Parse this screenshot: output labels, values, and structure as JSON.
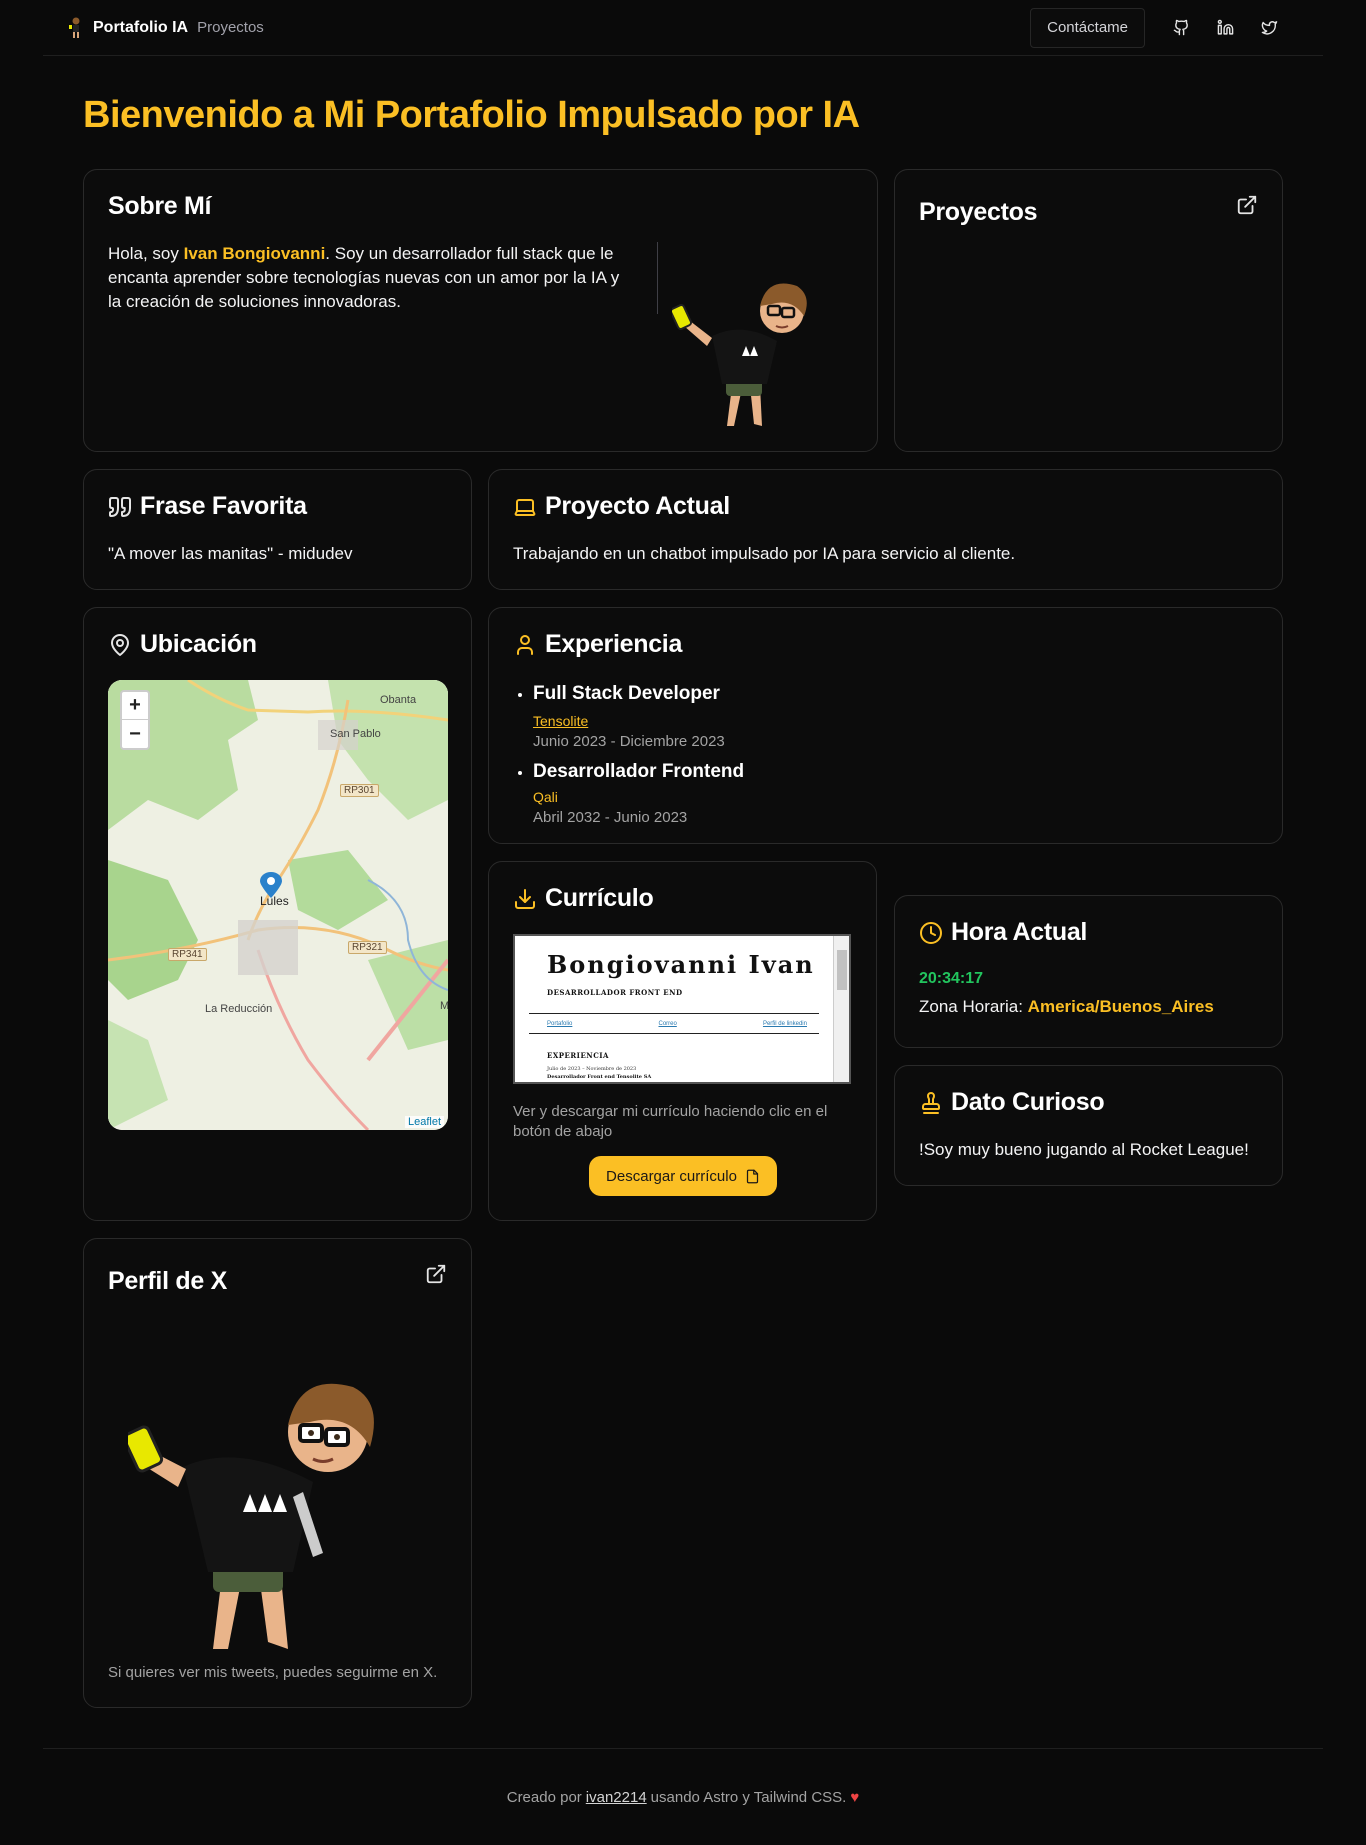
{
  "nav": {
    "brand": "Portafolio IA",
    "link_projects": "Proyectos",
    "contact_label": "Contáctame",
    "icons": [
      "github-icon",
      "linkedin-icon",
      "twitter-icon"
    ]
  },
  "page_title": "Bienvenido a Mi Portafolio Impulsado por IA",
  "about": {
    "title": "Sobre Mí",
    "intro": "Hola, soy",
    "name": "Ivan Bongiovanni",
    "rest": ". Soy un desarrollador full stack que le encanta aprender sobre tecnologías nuevas con un amor por la IA y la creación de soluciones innovadoras."
  },
  "projects": {
    "title": "Proyectos"
  },
  "quote": {
    "title": "Frase Favorita",
    "text": "\"A mover las manitas\" - midudev"
  },
  "current_project": {
    "title": "Proyecto Actual",
    "text": "Trabajando en un chatbot impulsado por IA para servicio al cliente."
  },
  "location": {
    "title": "Ubicación",
    "map_labels": [
      "Obanta",
      "San Pablo",
      "Lules",
      "La Reducción",
      "M"
    ],
    "road_tags": [
      "RP301",
      "RP321",
      "RP341"
    ],
    "attribution": "Leaflet",
    "zoom_in": "+",
    "zoom_out": "−"
  },
  "experience": {
    "title": "Experiencia",
    "items": [
      {
        "role": "Full Stack Developer",
        "company": "Tensolite",
        "dates": "Junio 2023 - Diciembre 2023"
      },
      {
        "role": "Desarrollador Frontend",
        "company": "Qali",
        "dates": "Abril 2032 - Junio 2023"
      }
    ]
  },
  "cv": {
    "title": "Currículo",
    "preview_name": "Bongiovanni Ivan",
    "preview_role": "DESARROLLADOR FRONT END",
    "preview_links": [
      "Portafolio",
      "Correo",
      "Perfil de linkedin"
    ],
    "preview_section": "EXPERIENCIA",
    "preview_line1": "Julio de 2023 – Noviembre de 2023",
    "preview_line2": "Desarrollador Front end Tensolite SA",
    "description": "Ver y descargar mi currículo haciendo clic en el botón de abajo",
    "button": "Descargar currículo"
  },
  "time": {
    "title": "Hora Actual",
    "clock": "20:34:17",
    "tz_label": "Zona Horaria:",
    "tz_value": "America/Buenos_Aires"
  },
  "fun_fact": {
    "title": "Dato Curioso",
    "text": "!Soy muy bueno jugando al Rocket League!"
  },
  "x_profile": {
    "title": "Perfil de X",
    "text": "Si quieres ver mis tweets, puedes seguirme en X."
  },
  "footer": {
    "prefix": "Creado por",
    "author": "ivan2214",
    "suffix": "usando Astro y Tailwind CSS.",
    "heart": "♥"
  },
  "colors": {
    "accent": "#fbbf24",
    "clock": "#22c55e",
    "background": "#0a0a0a"
  }
}
